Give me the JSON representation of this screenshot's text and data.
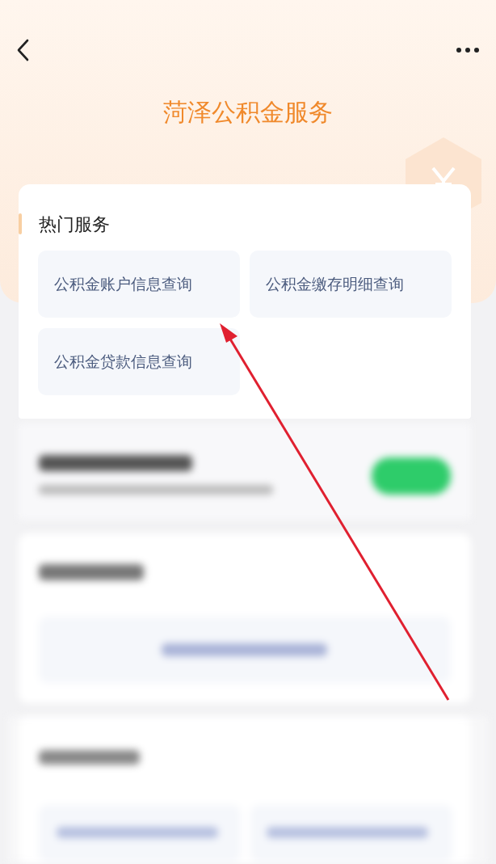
{
  "title": "菏泽公积金服务",
  "hot_services": {
    "title": "热门服务",
    "items": [
      {
        "label": "公积金账户信息查询"
      },
      {
        "label": "公积金缴存明细查询"
      },
      {
        "label": "公积金贷款信息查询"
      }
    ]
  }
}
